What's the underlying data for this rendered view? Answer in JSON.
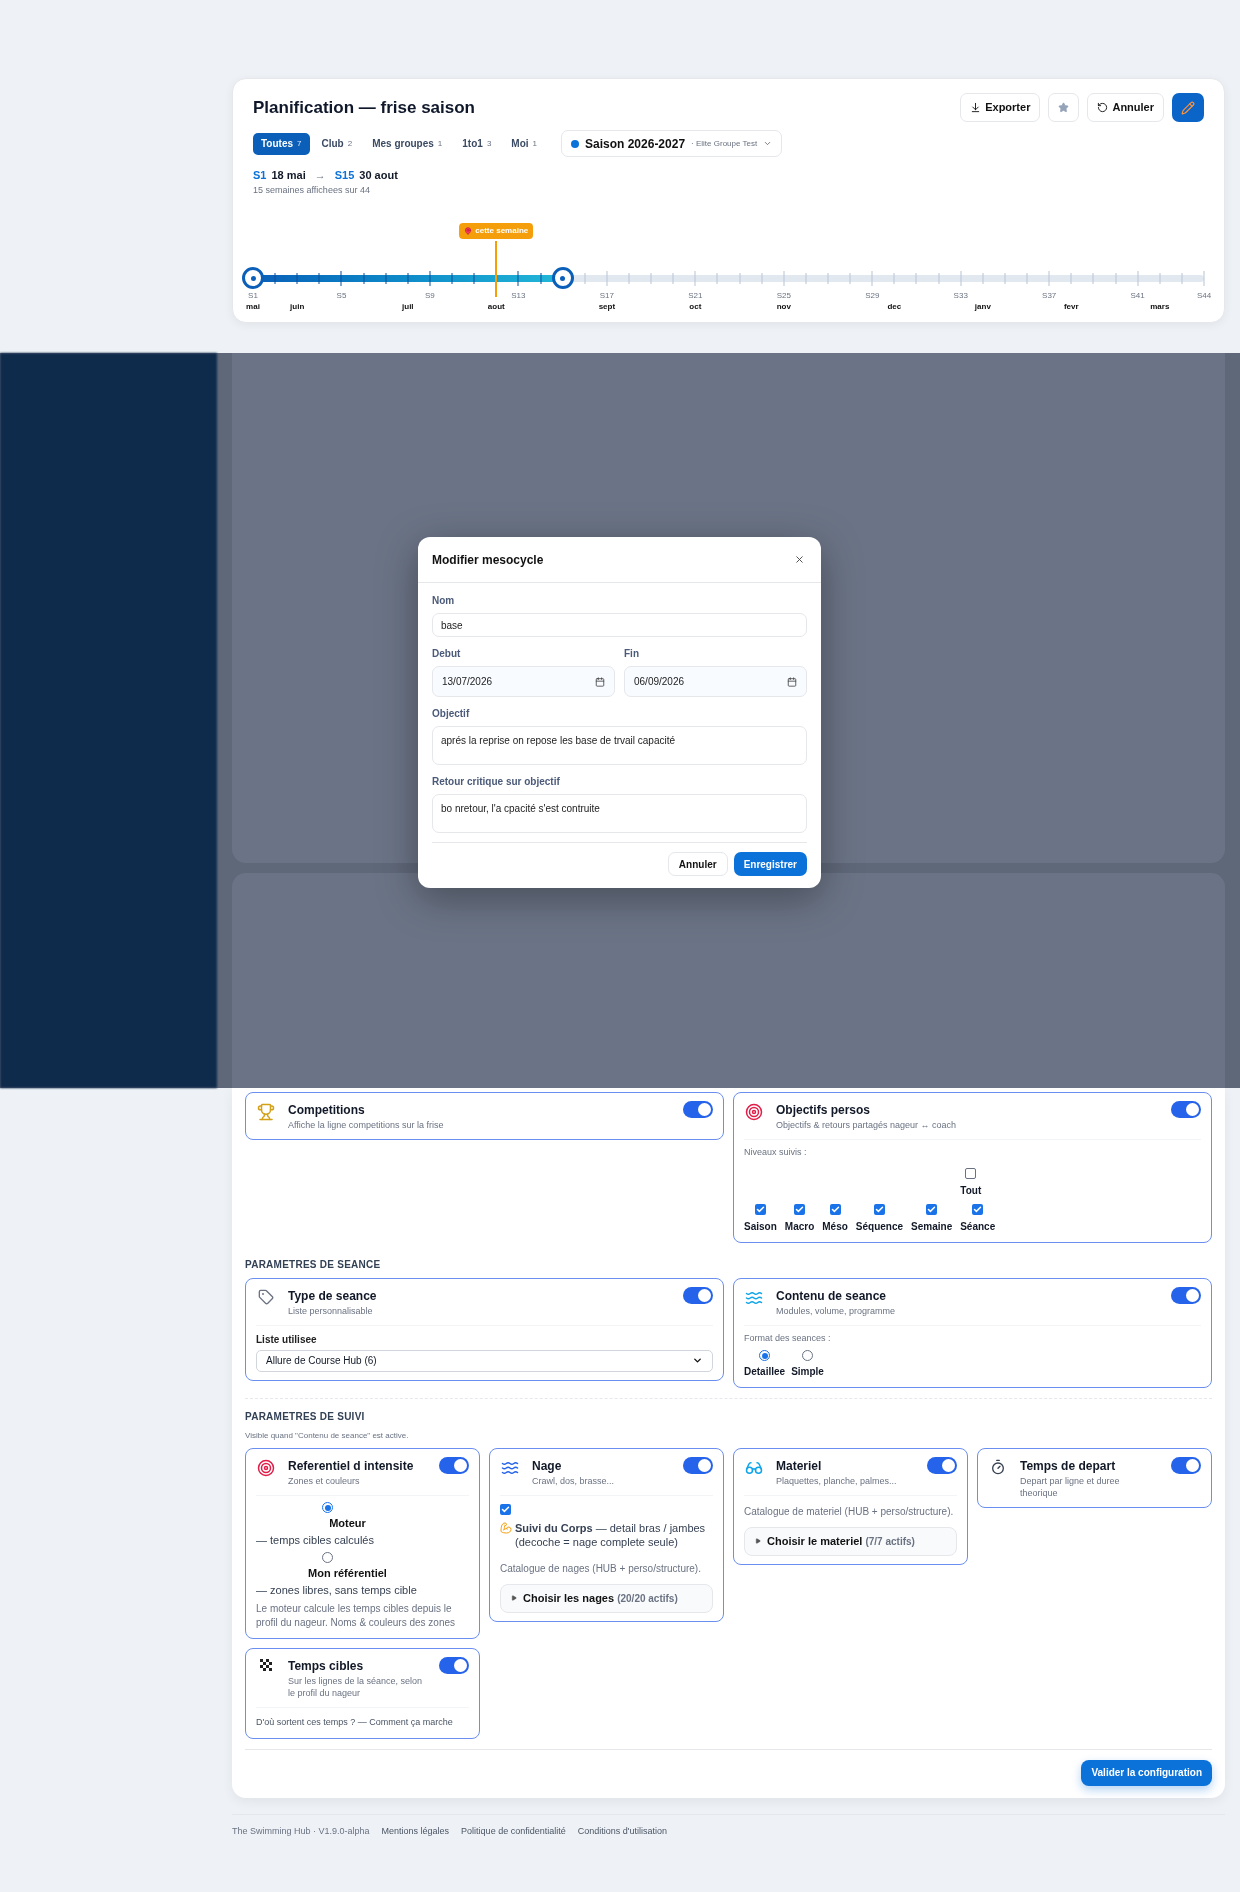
{
  "planning": {
    "title": "Planification — frise saison",
    "actions": [
      {
        "kind": "export",
        "label": "Exporter"
      },
      {
        "kind": "star"
      },
      {
        "kind": "undo",
        "label": "Annuler"
      },
      {
        "kind": "edit"
      }
    ],
    "filters": [
      {
        "label": "Toutes",
        "count": "7",
        "selected": true
      },
      {
        "label": "Club",
        "count": "2",
        "selected": false
      },
      {
        "label": "Mes groupes",
        "count": "1",
        "selected": false
      },
      {
        "label": "1to1",
        "count": "3",
        "selected": false
      },
      {
        "label": "Moi",
        "count": "1",
        "selected": false
      }
    ],
    "season": {
      "name": "Saison 2026-2027",
      "group": "· Elite Groupe Test"
    },
    "range": {
      "start_week": "S1",
      "start_date": "18 mai",
      "arrow": "→",
      "end_week": "S15",
      "end_date": "30 aout",
      "summary": "15 semaines affichees sur 44"
    },
    "timeline": {
      "marker": "cette semaine",
      "weeks": [
        {
          "label": "S1",
          "month": "mai",
          "in_range": true,
          "current": false
        },
        {
          "in_range": true,
          "current": false
        },
        {
          "month": "juin",
          "in_range": true,
          "current": false
        },
        {
          "in_range": true,
          "current": false
        },
        {
          "label": "S5",
          "in_range": true,
          "current": false
        },
        {
          "in_range": true,
          "current": false
        },
        {
          "in_range": true,
          "current": false
        },
        {
          "month": "juil",
          "in_range": true,
          "current": false
        },
        {
          "label": "S9",
          "in_range": true,
          "current": false
        },
        {
          "in_range": true,
          "current": false
        },
        {
          "in_range": true,
          "current": false
        },
        {
          "month": "aout",
          "in_range": true,
          "current": true
        },
        {
          "label": "S13",
          "in_range": true,
          "current": false
        },
        {
          "in_range": true,
          "current": false
        },
        {
          "in_range": true,
          "current": false
        },
        {
          "in_range": false,
          "current": false
        },
        {
          "label": "S17",
          "month": "sept",
          "in_range": false,
          "current": false
        },
        {
          "in_range": false,
          "current": false
        },
        {
          "in_range": false,
          "current": false
        },
        {
          "in_range": false,
          "current": false
        },
        {
          "label": "S21",
          "month": "oct",
          "in_range": false,
          "current": false
        },
        {
          "in_range": false,
          "current": false
        },
        {
          "in_range": false,
          "current": false
        },
        {
          "in_range": false,
          "current": false
        },
        {
          "label": "S25",
          "month": "nov",
          "in_range": false,
          "current": false
        },
        {
          "in_range": false,
          "current": false
        },
        {
          "in_range": false,
          "current": false
        },
        {
          "in_range": false,
          "current": false
        },
        {
          "label": "S29",
          "in_range": false,
          "current": false
        },
        {
          "month": "dec",
          "in_range": false,
          "current": false
        },
        {
          "in_range": false,
          "current": false
        },
        {
          "in_range": false,
          "current": false
        },
        {
          "label": "S33",
          "in_range": false,
          "current": false
        },
        {
          "month": "janv",
          "in_range": false,
          "current": false
        },
        {
          "in_range": false,
          "current": false
        },
        {
          "in_range": false,
          "current": false
        },
        {
          "label": "S37",
          "in_range": false,
          "current": false
        },
        {
          "month": "fevr",
          "in_range": false,
          "current": false
        },
        {
          "in_range": false,
          "current": false
        },
        {
          "in_range": false,
          "current": false
        },
        {
          "label": "S41",
          "in_range": false,
          "current": false
        },
        {
          "month": "mars",
          "in_range": false,
          "current": false
        },
        {
          "in_range": false,
          "current": false
        },
        {
          "label": "S44",
          "in_range": false,
          "current": false
        }
      ]
    }
  },
  "modal": {
    "title": "Modifier mesocycle",
    "name": {
      "label": "Nom",
      "value": "base"
    },
    "dates": [
      {
        "label": "Debut",
        "value": "13/07/2026"
      },
      {
        "label": "Fin",
        "value": "06/09/2026"
      }
    ],
    "objective": {
      "label": "Objectif",
      "value": "aprés la reprise on repose les base de trvail capacité"
    },
    "review": {
      "label": "Retour critique sur objectif",
      "value": "bo nretour, l'a cpacité s'est contruite"
    },
    "buttons": [
      {
        "kind": "cancel",
        "label": "Annuler"
      },
      {
        "kind": "save",
        "label": "Enregistrer"
      }
    ]
  },
  "season_params": [
    {
      "kind": "competitions",
      "title": "Competitions",
      "subtitle": "Affiche la ligne competitions sur la frise",
      "on": true
    },
    {
      "kind": "objectives",
      "title": "Objectifs persos",
      "subtitle": "Objectifs & retours partagés nageur ↔ coach",
      "on": true,
      "levels_label": "Niveaux suivis :",
      "all": {
        "label": "Tout",
        "checked": false
      },
      "levels": [
        {
          "label": "Saison",
          "checked": true
        },
        {
          "label": "Macro",
          "checked": true
        },
        {
          "label": "Méso",
          "checked": true
        },
        {
          "label": "Séquence",
          "checked": true
        },
        {
          "label": "Semaine",
          "checked": true
        },
        {
          "label": "Séance",
          "checked": true
        }
      ]
    }
  ],
  "session_params": {
    "heading": "PARAMETRES DE SEANCE",
    "cards": [
      {
        "kind": "type",
        "title": "Type de seance",
        "subtitle": "Liste personnalisable",
        "on": true,
        "field_label": "Liste utilisee",
        "value": "Allure de Course Hub (6)"
      },
      {
        "kind": "content",
        "title": "Contenu de seance",
        "subtitle": "Modules, volume, programme",
        "on": true,
        "format_label": "Format des seances :",
        "formats": [
          {
            "label": "Detaillee",
            "selected": true
          },
          {
            "label": "Simple",
            "selected": false
          }
        ]
      }
    ]
  },
  "tracking_params": {
    "heading": "PARAMETRES DE SUIVI",
    "note": "Visible quand \"Contenu de seance\" est active.",
    "columns": [
      [
        {
          "kind": "intensity",
          "title": "Referentiel d intensite",
          "subtitle": "Zones et couleurs",
          "on": true,
          "options": [
            {
              "label": "Moteur",
              "detail": "— temps cibles calculés",
              "selected": true
            },
            {
              "label": "Mon référentiel",
              "detail": "— zones libres, sans temps cible",
              "selected": false
            }
          ],
          "note": "Le moteur calcule les temps cibles depuis le profil du nageur. Noms & couleurs des zones"
        },
        {
          "kind": "targets",
          "title": "Temps cibles",
          "subtitle": "Sur les lignes de la séance, selon le profil du nageur",
          "on": true,
          "note": "D'où sortent ces temps ? — Comment ça marche"
        }
      ],
      [
        {
          "kind": "swim",
          "title": "Nage",
          "subtitle": "Crawl, dos, brasse...",
          "on": true,
          "option": {
            "text": "**Suivi du Corps** — detail bras / jambes (decoche = nage complete seule)",
            "checked": true
          },
          "note": "Catalogue de nages (HUB + perso/structure).",
          "picker": {
            "label": "Choisir les nages",
            "count": "(20/20 actifs)"
          }
        }
      ],
      [
        {
          "kind": "equipment",
          "title": "Materiel",
          "subtitle": "Plaquettes, planche, palmes...",
          "on": true,
          "note": "Catalogue de materiel (HUB + perso/structure).",
          "picker": {
            "label": "Choisir le materiel",
            "count": "(7/7 actifs)"
          }
        }
      ],
      [
        {
          "kind": "start",
          "title": "Temps de depart",
          "subtitle": "Depart par ligne et duree theorique",
          "on": true
        }
      ]
    ]
  },
  "submit": "Valider la configuration",
  "footer": [
    {
      "kind": "text",
      "label": "The Swimming Hub · V1.9.0-alpha"
    },
    {
      "kind": "link",
      "label": "Mentions légales"
    },
    {
      "kind": "link",
      "label": "Politique de confidentialité"
    },
    {
      "kind": "link",
      "label": "Conditions d'utilisation"
    }
  ]
}
